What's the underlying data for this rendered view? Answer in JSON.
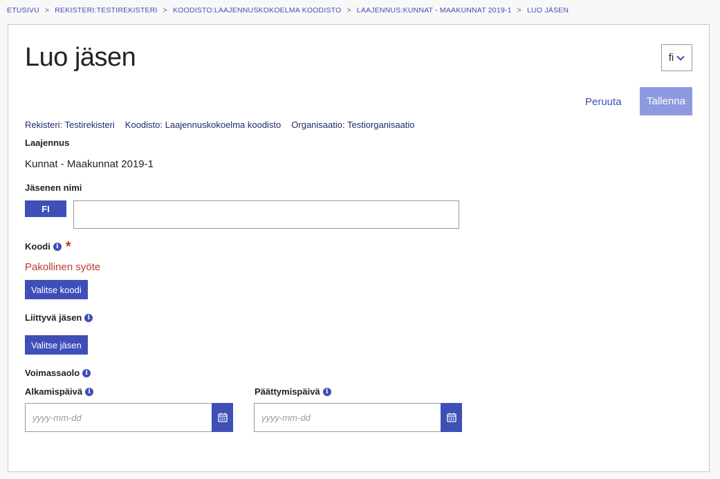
{
  "breadcrumb": [
    {
      "label": "Etusivu"
    },
    {
      "label": "Rekisteri:Testirekisteri"
    },
    {
      "label": "Koodisto:Laajennuskokoelma koodisto"
    },
    {
      "label": "Laajennus:Kunnat - Maakunnat 2019-1"
    },
    {
      "label": "Luo jäsen"
    }
  ],
  "breadcrumb_separator": ">",
  "page": {
    "title": "Luo jäsen"
  },
  "language_select": {
    "value": "fi"
  },
  "actions": {
    "cancel_label": "Peruuta",
    "save_label": "Tallenna"
  },
  "meta": {
    "registry": "Rekisteri: Testirekisteri",
    "codelist": "Koodisto: Laajennuskokoelma koodisto",
    "organization": "Organisaatio: Testiorganisaatio"
  },
  "extension": {
    "label": "Laajennus",
    "value": "Kunnat - Maakunnat 2019-1"
  },
  "member_name": {
    "label": "Jäsenen nimi",
    "lang_badge": "FI",
    "value": ""
  },
  "code": {
    "label": "Koodi",
    "required_mark": "*",
    "error": "Pakollinen syöte",
    "button_label": "Valitse koodi"
  },
  "related_member": {
    "label": "Liittyvä jäsen",
    "button_label": "Valitse jäsen"
  },
  "validity": {
    "label": "Voimassaolo",
    "start": {
      "label": "Alkamispäivä",
      "placeholder": "yyyy-mm-dd"
    },
    "end": {
      "label": "Päättymispäivä",
      "placeholder": "yyyy-mm-dd"
    }
  },
  "icons": {
    "info": "info-icon",
    "calendar": "calendar-icon",
    "chevron": "chevron-down-icon"
  },
  "colors": {
    "accent": "#3e4fb8",
    "accent_disabled": "#8d9ae0",
    "error": "#c0392b"
  }
}
